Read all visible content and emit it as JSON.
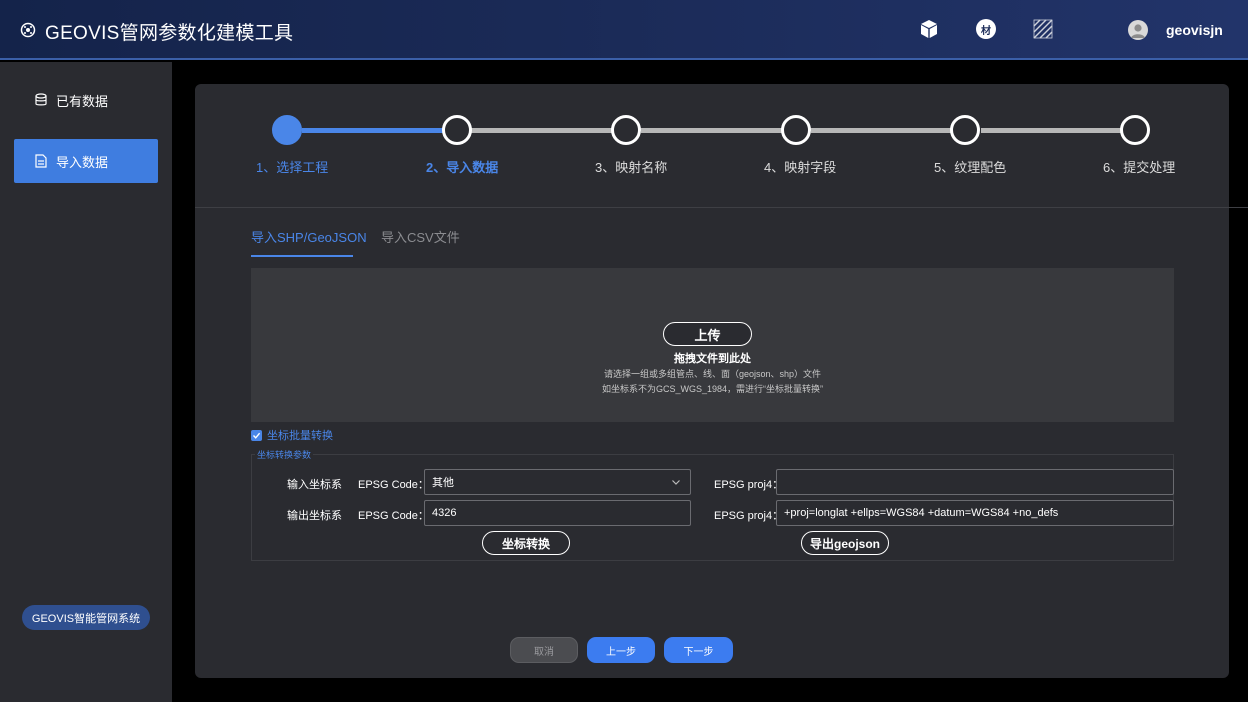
{
  "header": {
    "title": "GEOVIS管网参数化建模工具",
    "logo_icon": "globe-logo-icon",
    "icons": [
      "cube-icon",
      "material-icon",
      "texture-hatch-icon"
    ],
    "material_glyph": "材",
    "user_name": "geovisjn"
  },
  "sidebar": {
    "items": [
      {
        "label": "已有数据",
        "icon": "database-icon",
        "active": false
      },
      {
        "label": "导入数据",
        "icon": "import-file-icon",
        "active": true
      }
    ],
    "badge": "GEOVIS智能管网系统"
  },
  "steps": [
    {
      "label": "1、选择工程",
      "state": "done"
    },
    {
      "label": "2、导入数据",
      "state": "current"
    },
    {
      "label": "3、映射名称",
      "state": "todo"
    },
    {
      "label": "4、映射字段",
      "state": "todo"
    },
    {
      "label": "5、纹理配色",
      "state": "todo"
    },
    {
      "label": "6、提交处理",
      "state": "todo"
    }
  ],
  "tabs": [
    {
      "label": "导入SHP/GeoJSON",
      "active": true
    },
    {
      "label": "导入CSV文件",
      "active": false
    }
  ],
  "upload": {
    "button": "上传",
    "title": "拖拽文件到此处",
    "hint1": "请选择一组或多组管点、线、面（geojson、shp）文件",
    "hint2": "如坐标系不为GCS_WGS_1984，需进行“坐标批量转换”"
  },
  "batch_convert": {
    "label": "坐标批量转换",
    "checked": true
  },
  "params": {
    "legend": "坐标转换参数",
    "input_label": "输入坐标系",
    "output_label": "输出坐标系",
    "epsg_code_label": "EPSG Code：",
    "epsg_proj4_label": "EPSG proj4：",
    "input_epsg_code": "其他",
    "input_proj4": "",
    "output_epsg_code": "4326",
    "output_proj4": "+proj=longlat +ellps=WGS84 +datum=WGS84 +no_defs",
    "convert_button": "坐标转换",
    "export_button": "导出geojson"
  },
  "footer": {
    "cancel": "取消",
    "prev": "上一步",
    "next": "下一步"
  },
  "colors": {
    "accent": "#4a86e8",
    "primary_button": "#3c7cf0",
    "panel": "#2a2b30",
    "header": "#1b2b58"
  }
}
